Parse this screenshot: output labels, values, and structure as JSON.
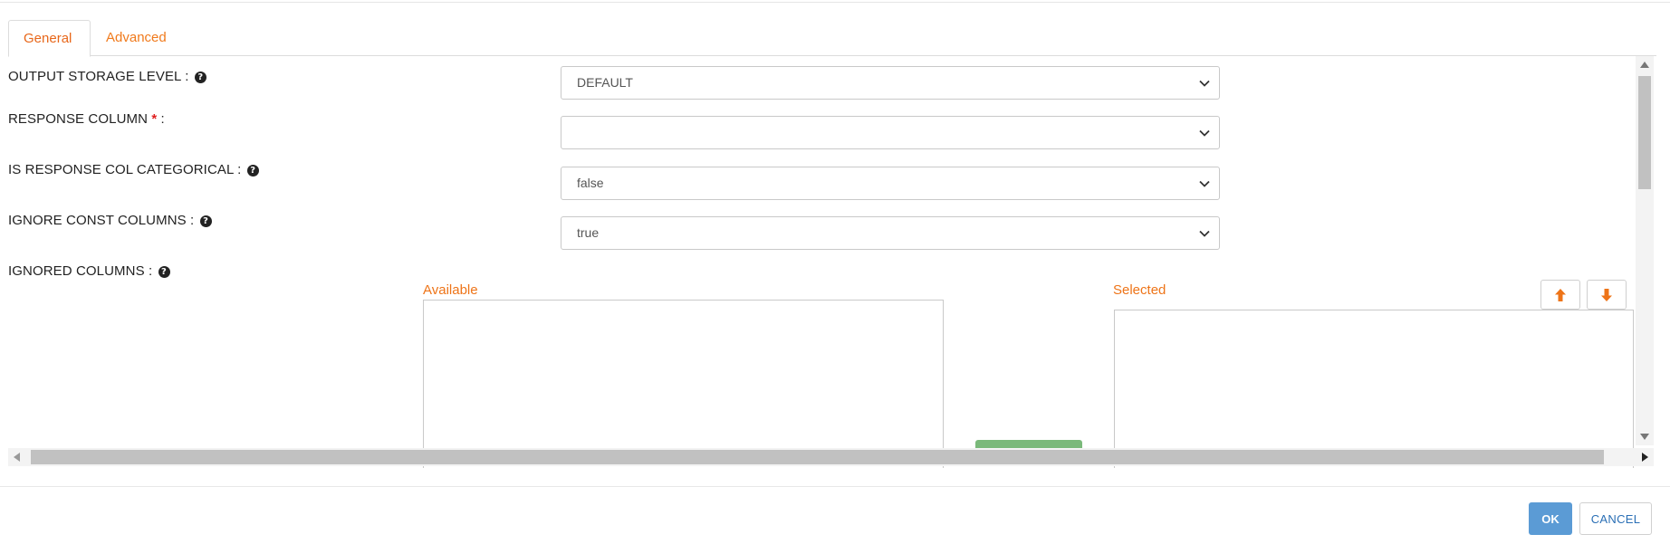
{
  "tabs": [
    {
      "label": "General",
      "active": true
    },
    {
      "label": "Advanced",
      "active": false
    }
  ],
  "fields": {
    "output_storage_level": {
      "label": "OUTPUT STORAGE LEVEL :",
      "value": "DEFAULT"
    },
    "response_column": {
      "label": "RESPONSE COLUMN",
      "required_mark": "*",
      "suffix": ":",
      "value": ""
    },
    "is_response_col_categorical": {
      "label": "IS RESPONSE COL CATEGORICAL :",
      "value": "false"
    },
    "ignore_const_columns": {
      "label": "IGNORE CONST COLUMNS :",
      "value": "true"
    },
    "ignored_columns": {
      "label": "IGNORED COLUMNS :",
      "available_label": "Available",
      "selected_label": "Selected"
    }
  },
  "icons": {
    "help": "question-circle-icon",
    "dropdown": "chevron-down-icon",
    "move_up": "arrow-up-icon",
    "move_down": "arrow-down-icon"
  },
  "colors": {
    "accent": "#ee7418",
    "ok_button": "#5b9bd5",
    "required": "#e02020",
    "transfer_button": "#7ab97a"
  },
  "footer": {
    "ok_label": "OK",
    "cancel_label": "CANCEL"
  }
}
